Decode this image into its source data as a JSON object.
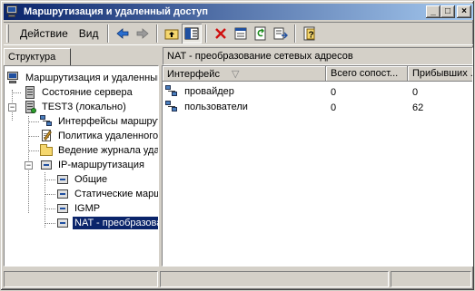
{
  "window": {
    "title": "Маршрутизация и удаленный доступ",
    "title_icon": "computer-network-icon",
    "caption_buttons": [
      "_",
      "□",
      "×"
    ]
  },
  "menu": {
    "action_label": "Действие",
    "view_label": "Вид"
  },
  "toolbar": {
    "buttons": [
      "back-arrow-icon",
      "forward-arrow-icon",
      "up-folder-icon",
      "show-hide-tree-icon",
      "delete-icon",
      "properties-icon",
      "refresh-icon",
      "export-list-icon",
      "help-icon"
    ]
  },
  "tree_tab": {
    "label": "Структура"
  },
  "right_header": {
    "label": "NAT - преобразование сетевых адресов"
  },
  "tree": {
    "items": [
      {
        "label": "Маршрутизация и удаленный доступ",
        "icon": "computer-network-icon"
      },
      {
        "label": "Состояние сервера",
        "icon": "server-icon"
      },
      {
        "label": "TEST3 (локально)",
        "icon": "server-running-icon"
      },
      {
        "label": "Интерфейсы маршрутизации",
        "icon": "network-interfaces-icon"
      },
      {
        "label": "Политика удаленного доступа",
        "icon": "policy-icon"
      },
      {
        "label": "Ведение журнала удаленного доступа",
        "icon": "folder-icon"
      },
      {
        "label": "IP-маршрутизация",
        "icon": "network-icon"
      },
      {
        "label": "Общие",
        "icon": "network-icon"
      },
      {
        "label": "Статические маршруты",
        "icon": "network-icon"
      },
      {
        "label": "IGMP",
        "icon": "network-icon"
      },
      {
        "label": "NAT - преобразование сетевых адресов",
        "icon": "network-icon"
      }
    ]
  },
  "list": {
    "columns": [
      "Интерфейс",
      "Всего сопост...",
      "Прибывших ..."
    ],
    "sort_indicator": "▽",
    "rows": [
      {
        "interface": "провайдер",
        "total": "0",
        "inbound": "0"
      },
      {
        "interface": "пользователи",
        "total": "0",
        "inbound": "62"
      }
    ]
  },
  "colors": {
    "title_gradient_start": "#0a246a",
    "title_gradient_end": "#a6caf0",
    "selection": "#0a246a",
    "face": "#d4d0c8"
  }
}
